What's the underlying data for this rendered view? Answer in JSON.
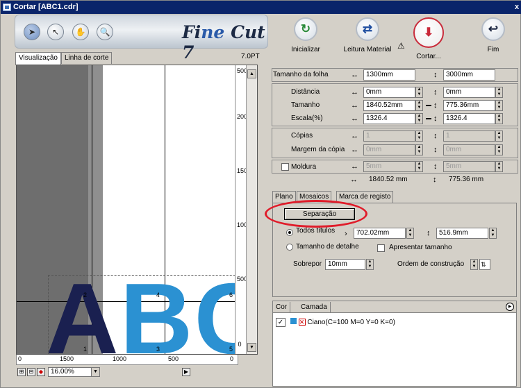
{
  "window": {
    "title": "Cortar [ABC1.cdr]",
    "close": "x"
  },
  "toolbar": {
    "tools": [
      {
        "name": "select-tool",
        "icon": "arrow-icon",
        "glyph": "➤"
      },
      {
        "name": "pick-tool",
        "icon": "pointer-icon",
        "glyph": "↖"
      },
      {
        "name": "hand-tool",
        "icon": "hand-icon",
        "glyph": "✋"
      },
      {
        "name": "zoom-tool",
        "icon": "magnifier-icon",
        "glyph": "🔍"
      }
    ],
    "logo_a": "Fi",
    "logo_e": "ne",
    "logo_b": "Cut 7"
  },
  "view_tabs": {
    "preview": "Visualização",
    "cutline": "Linha de corte"
  },
  "point_size": "7.0PT",
  "preview": {
    "letters": {
      "a": "A",
      "b": "B",
      "c": "C"
    },
    "tiles": [
      "2",
      "4",
      "6",
      "1",
      "3",
      "5"
    ],
    "vruler_labels": [
      "500",
      "2000",
      "1500",
      "1000",
      "500",
      "0"
    ],
    "hruler_labels": [
      "0",
      "1500",
      "1000",
      "500",
      "0"
    ],
    "zoom": "16.00%"
  },
  "actions": {
    "init": {
      "label": "Inicializar",
      "glyph": "↻"
    },
    "read": {
      "label": "Leitura Material",
      "glyph": "⇄"
    },
    "cut": {
      "label": "Cortar...",
      "glyph": "⬇"
    },
    "end": {
      "label": "Fim",
      "glyph": "↩"
    },
    "warning_glyph": "⚠"
  },
  "sheet": {
    "label": "Tamanho da folha",
    "w": "1300mm",
    "h": "3000mm"
  },
  "object": {
    "distance_label": "Distância",
    "dist_x": "0mm",
    "dist_y": "0mm",
    "size_label": "Tamanho",
    "size_w": "1840.52mm",
    "size_h": "775.36mm",
    "scale_label": "Escala(%)",
    "scale_x": "1326.4",
    "scale_y": "1326.4"
  },
  "copies": {
    "label": "Cópias",
    "x": "1",
    "y": "1",
    "margin_label": "Margem da cópia",
    "mx": "0mm",
    "my": "0mm"
  },
  "frame": {
    "label": "Moldura",
    "x": "5mm",
    "y": "5mm",
    "total_w": "1840.52 mm",
    "total_h": "775.36 mm"
  },
  "settings_tabs": {
    "plan": "Plano",
    "tiles": "Mosaicos",
    "reg": "Marca de registo"
  },
  "mosaic": {
    "separate": "Separação",
    "all_tiles": "Todos títulos",
    "tile_w": "702.02mm",
    "tile_h": "516.9mm",
    "detail_size": "Tamanho de detalhe",
    "show_size": "Apresentar tamanho",
    "overlap_label": "Sobrepor",
    "overlap": "10mm",
    "order_label": "Ordem de construção"
  },
  "layers": {
    "tab_color": "Cor",
    "tab_layer": "Camada",
    "row": "Ciano(C=100 M=0 Y=0 K=0)",
    "cyan": "#2b91d2"
  }
}
